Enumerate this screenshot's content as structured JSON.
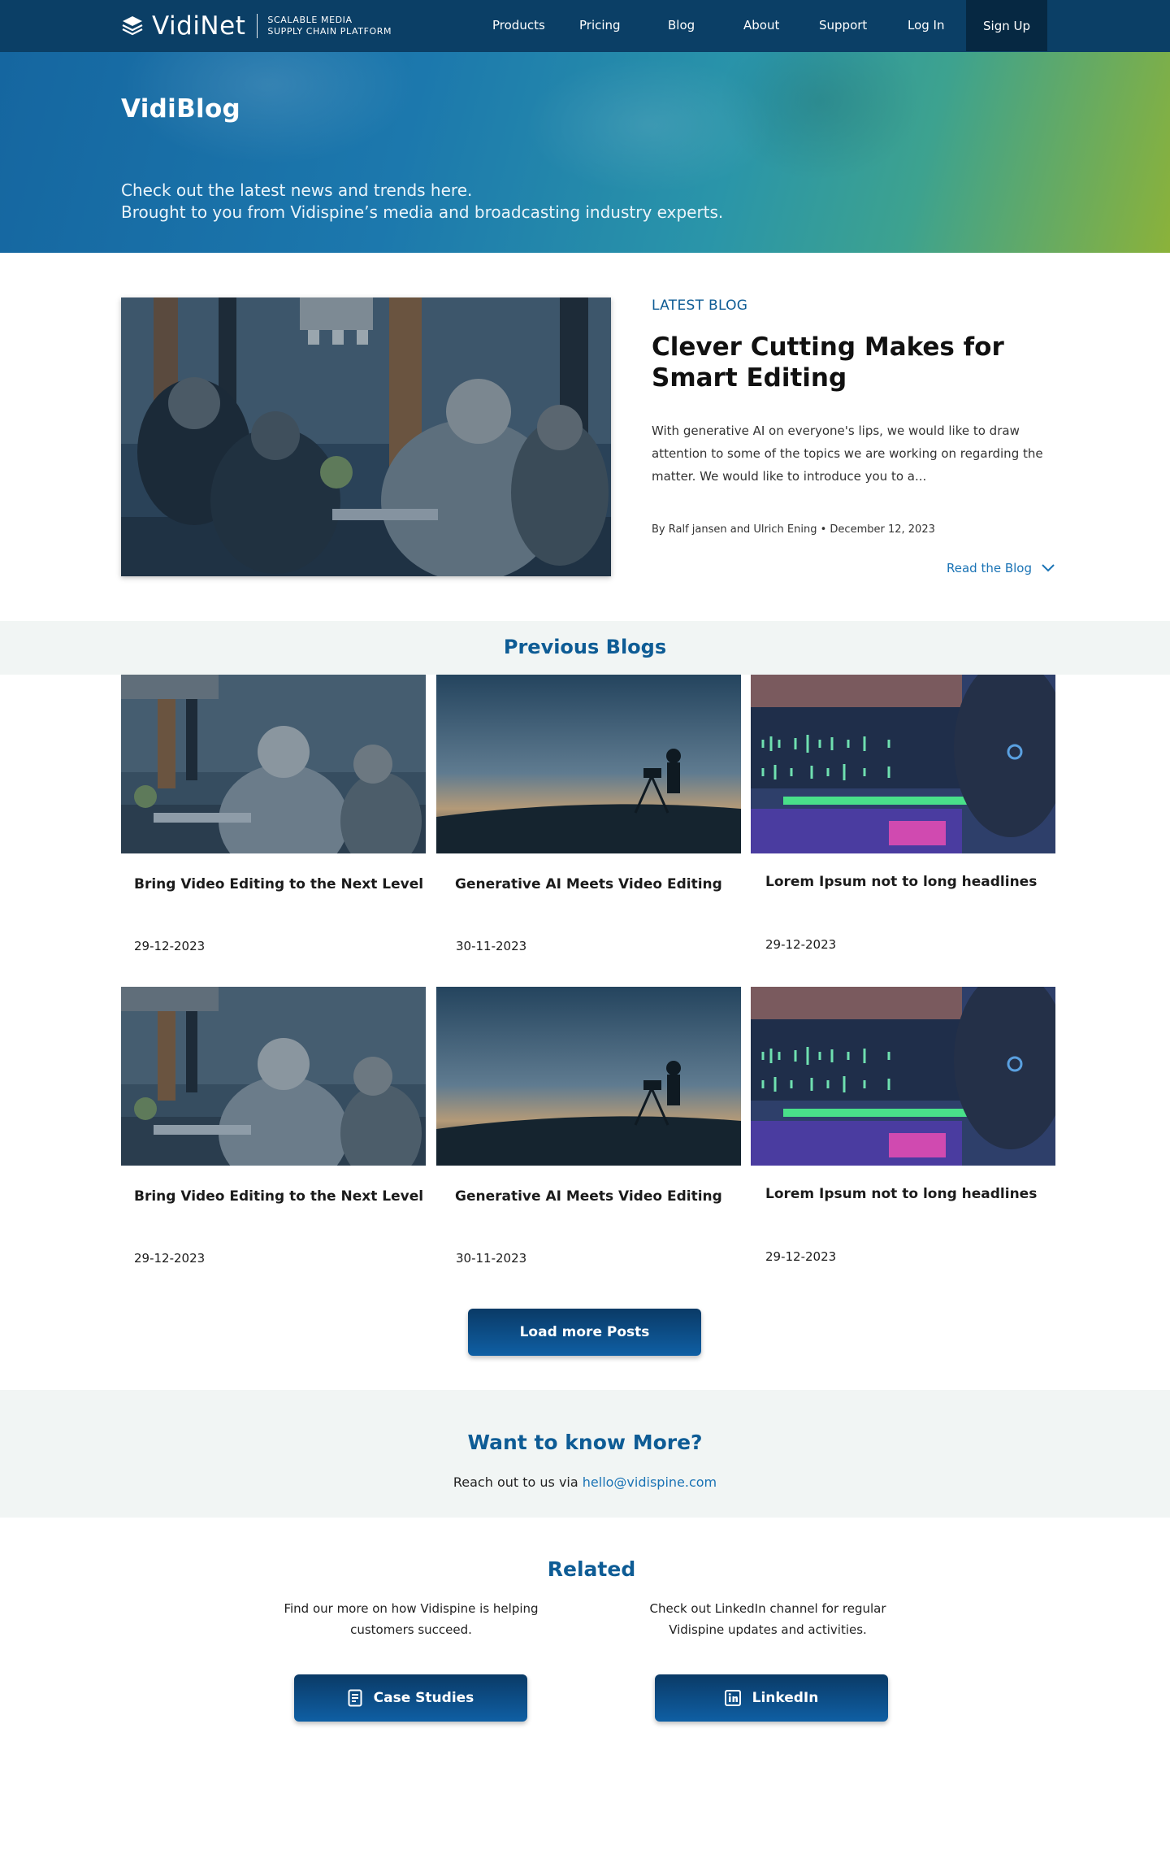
{
  "nav": {
    "brand": "VidiNet",
    "tagline_line1": "SCALABLE MEDIA",
    "tagline_line2": "SUPPLY CHAIN PLATFORM",
    "links": [
      "Products",
      "Pricing",
      "Blog",
      "About",
      "Support",
      "Log In"
    ],
    "signup": "Sign Up"
  },
  "hero": {
    "title": "VidiBlog",
    "subtitle_line1": "Check out the latest news and trends here.",
    "subtitle_line2": "Brought to you from Vidispine’s media and broadcasting industry experts."
  },
  "latest": {
    "tag": "LATEST BLOG",
    "title": "Clever Cutting Makes for Smart Editing",
    "excerpt": "With generative AI on everyone's lips, we would like to draw attention to some of the topics we are working on regarding the matter. We would like to introduce you to a...",
    "byline": "By Ralf jansen and Ulrich Ening • December 12, 2023",
    "read_label": "Read the Blog"
  },
  "previous": {
    "title": "Previous Blogs",
    "cards": [
      {
        "title": "Bring Video Editing to the Next Level",
        "date": "29-12-2023",
        "image": "office-team"
      },
      {
        "title": "Generative AI Meets Video Editing",
        "date": "30-11-2023",
        "image": "camera-silhouette"
      },
      {
        "title": "Lorem Ipsum not to long headlines",
        "date": "29-12-2023",
        "image": "audio-editing"
      },
      {
        "title": "Bring Video Editing to the Next Level",
        "date": "29-12-2023",
        "image": "office-team"
      },
      {
        "title": "Generative AI Meets Video Editing",
        "date": "30-11-2023",
        "image": "camera-silhouette"
      },
      {
        "title": "Lorem Ipsum not to long headlines",
        "date": "29-12-2023",
        "image": "audio-editing"
      }
    ],
    "load_more": "Load more Posts"
  },
  "contact": {
    "title": "Want to know More?",
    "text": "Reach out to us via",
    "email": "hello@vidispine.com"
  },
  "related": {
    "title": "Related",
    "left_text": "Find our more on how Vidispine is helping customers succeed.",
    "right_text": "Check out LinkedIn channel for regular Vidispine updates and activities.",
    "case_studies": "Case Studies",
    "linkedin": "LinkedIn"
  },
  "colors": {
    "nav_bg": "#0b3f66",
    "accent_blue": "#0e5c95",
    "link_blue": "#1a73b5",
    "band_bg": "#f1f5f4"
  },
  "icons": [
    "vidinet-logo-icon",
    "chevron-down-icon",
    "document-icon",
    "linkedin-icon"
  ]
}
